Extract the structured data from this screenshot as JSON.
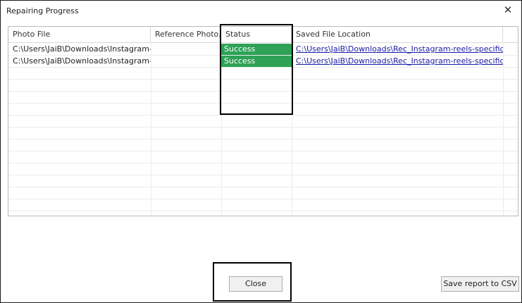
{
  "window": {
    "title": "Repairing Progress",
    "close_glyph": "✕"
  },
  "table": {
    "columns": [
      "Photo File",
      "Reference Photo...",
      "Status",
      "Saved File Location"
    ],
    "rows": [
      {
        "photo_file": "C:\\Users\\JaiB\\Downloads\\Instagram-...",
        "reference_photo": "",
        "status": "Success",
        "saved_location": "C:\\Users\\JaiB\\Downloads\\Rec_Instagram-reels-specific-1..."
      },
      {
        "photo_file": "C:\\Users\\JaiB\\Downloads\\Instagram-...",
        "reference_photo": "",
        "status": "Success",
        "saved_location": "C:\\Users\\JaiB\\Downloads\\Rec_Instagram-reels-specific-1..."
      }
    ]
  },
  "buttons": {
    "close_label": "Close",
    "save_csv_label": "Save report to CSV"
  },
  "colors": {
    "success": "#2da256",
    "link": "#1a1aa6"
  }
}
